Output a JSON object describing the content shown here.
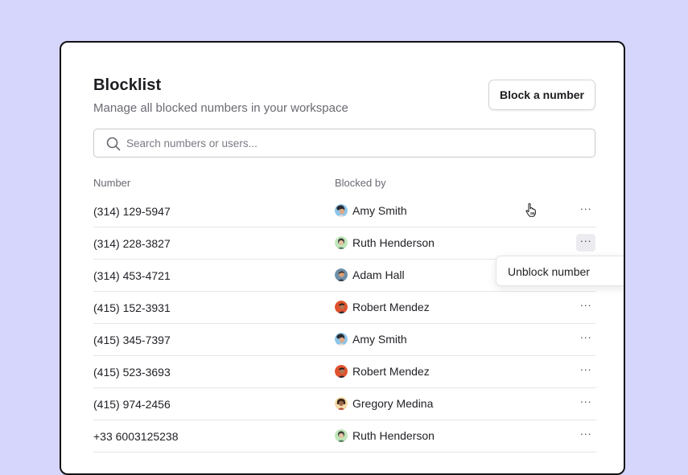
{
  "header": {
    "title": "Blocklist",
    "subtitle": "Manage all blocked numbers in your workspace",
    "block_button_label": "Block a number"
  },
  "search": {
    "placeholder": "Search numbers or users...",
    "value": ""
  },
  "table": {
    "columns": [
      "Number",
      "Blocked by"
    ],
    "rows": [
      {
        "number": "(314) 129-5947",
        "blocked_by": "Amy Smith",
        "avatar": "amy"
      },
      {
        "number": "(314) 228-3827",
        "blocked_by": "Ruth Henderson",
        "avatar": "ruth"
      },
      {
        "number": "(314) 453-4721",
        "blocked_by": "Adam Hall",
        "avatar": "adam"
      },
      {
        "number": "(415) 152-3931",
        "blocked_by": "Robert Mendez",
        "avatar": "robert"
      },
      {
        "number": "(415) 345-7397",
        "blocked_by": "Amy Smith",
        "avatar": "amy"
      },
      {
        "number": "(415) 523-3693",
        "blocked_by": "Robert Mendez",
        "avatar": "robert"
      },
      {
        "number": "(415) 974-2456",
        "blocked_by": "Gregory Medina",
        "avatar": "gregory"
      },
      {
        "number": "+33 6003125238",
        "blocked_by": "Ruth Henderson",
        "avatar": "ruth"
      }
    ]
  },
  "row_menu": {
    "open_row": 1,
    "items": [
      "Unblock number"
    ]
  },
  "icons": {
    "search": "search-icon",
    "more": "more-horizontal-icon",
    "cursor": "pointer-hand-cursor-icon"
  },
  "colors": {
    "background": "#d6d6fd",
    "card_border": "#121214",
    "text_primary": "#1d1d22",
    "text_secondary": "#6a6a73"
  }
}
